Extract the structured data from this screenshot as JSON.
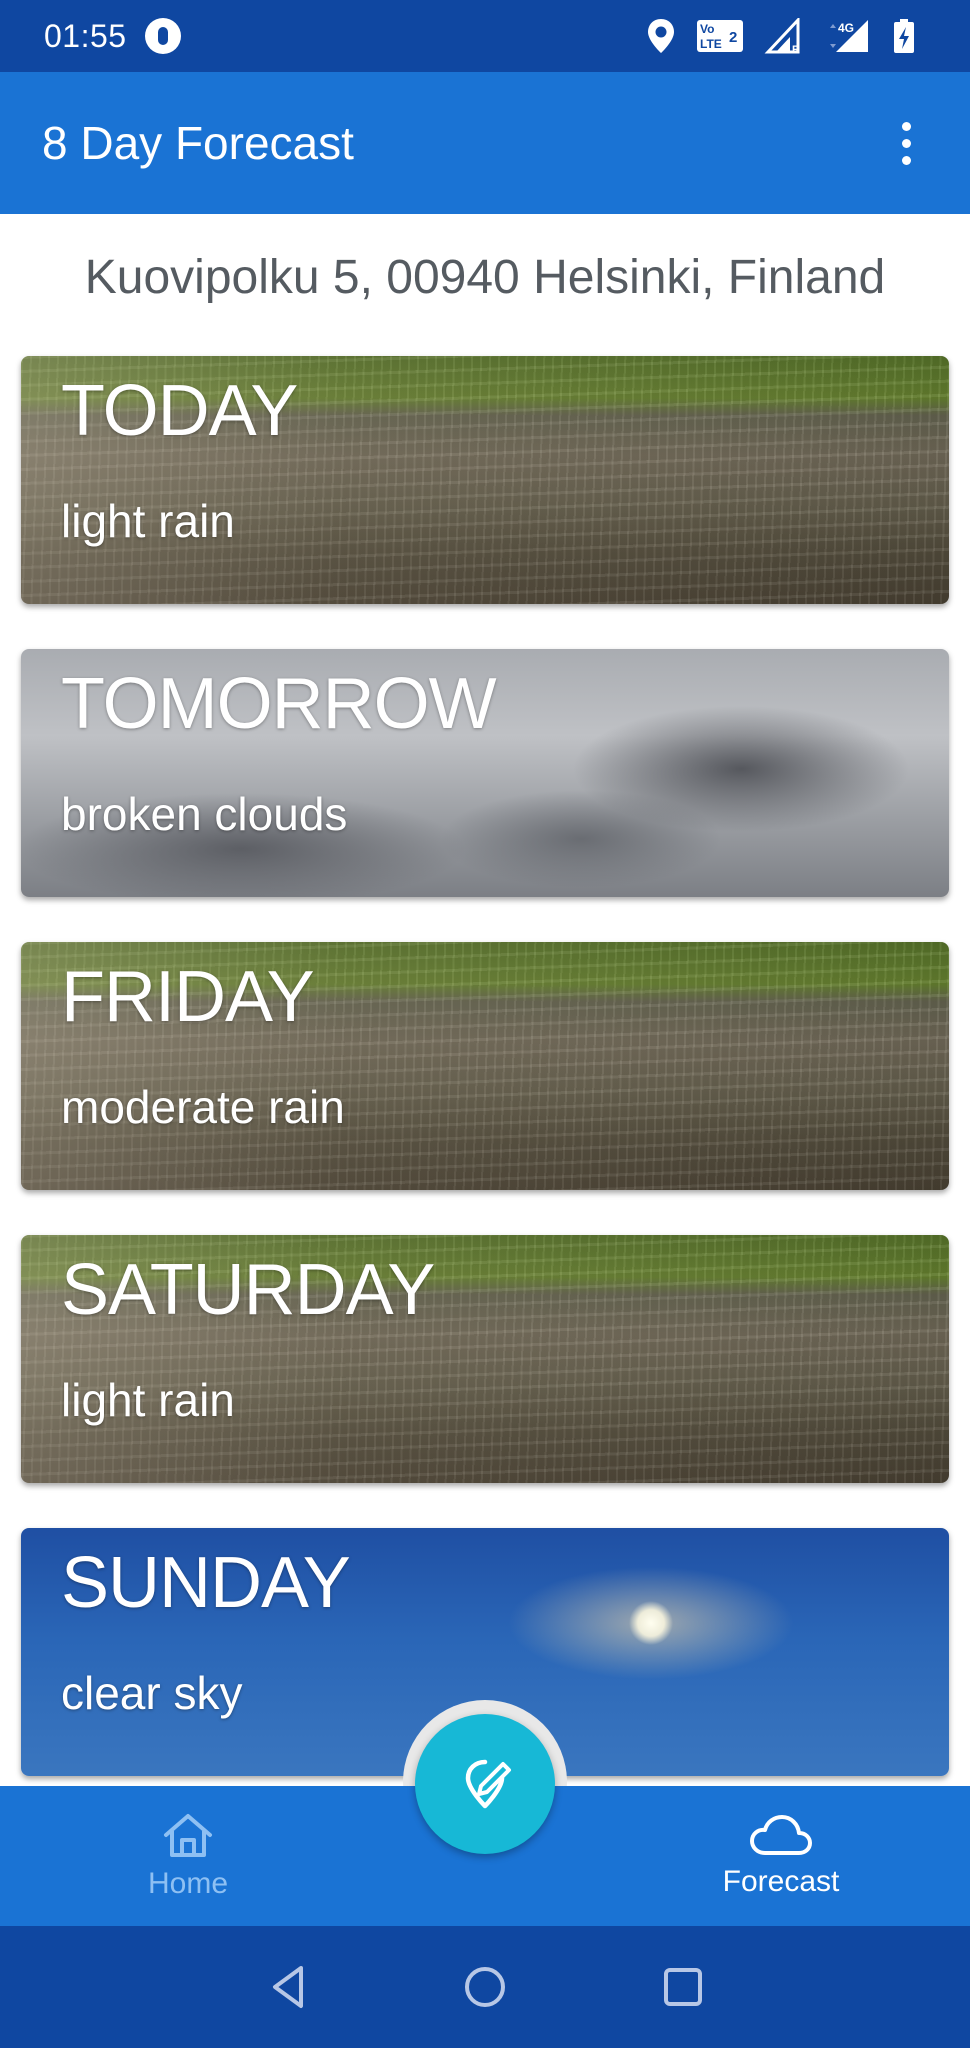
{
  "status_bar": {
    "time": "01:55",
    "lte_label": "Vo LTE2",
    "network_label": "4G"
  },
  "app_bar": {
    "title": "8 Day Forecast",
    "menu_icon": "more-vert-icon"
  },
  "location": {
    "address": "Kuovipolku 5, 00940 Helsinki, Finland"
  },
  "forecast": [
    {
      "day": "TODAY",
      "description": "light rain",
      "background": "rain"
    },
    {
      "day": "TOMORROW",
      "description": "broken clouds",
      "background": "clouds"
    },
    {
      "day": "FRIDAY",
      "description": "moderate rain",
      "background": "rain"
    },
    {
      "day": "SATURDAY",
      "description": "light rain",
      "background": "rain"
    },
    {
      "day": "SUNDAY",
      "description": "clear sky",
      "background": "clear"
    }
  ],
  "bottom_nav": {
    "items": [
      {
        "label": "Home",
        "icon": "home-icon",
        "selected": false
      },
      {
        "label": "Forecast",
        "icon": "cloud-icon",
        "selected": true
      }
    ],
    "fab_icon": "location-edit-icon"
  },
  "colors": {
    "status_bar": "#0f47a1",
    "app_bar": "#1a73d4",
    "fab": "#17b8d6",
    "home_label_inactive": "#8ec0f3",
    "address_text": "#555b61"
  },
  "system_nav": {
    "buttons": [
      "back-icon",
      "home-circle-icon",
      "recents-icon"
    ]
  }
}
